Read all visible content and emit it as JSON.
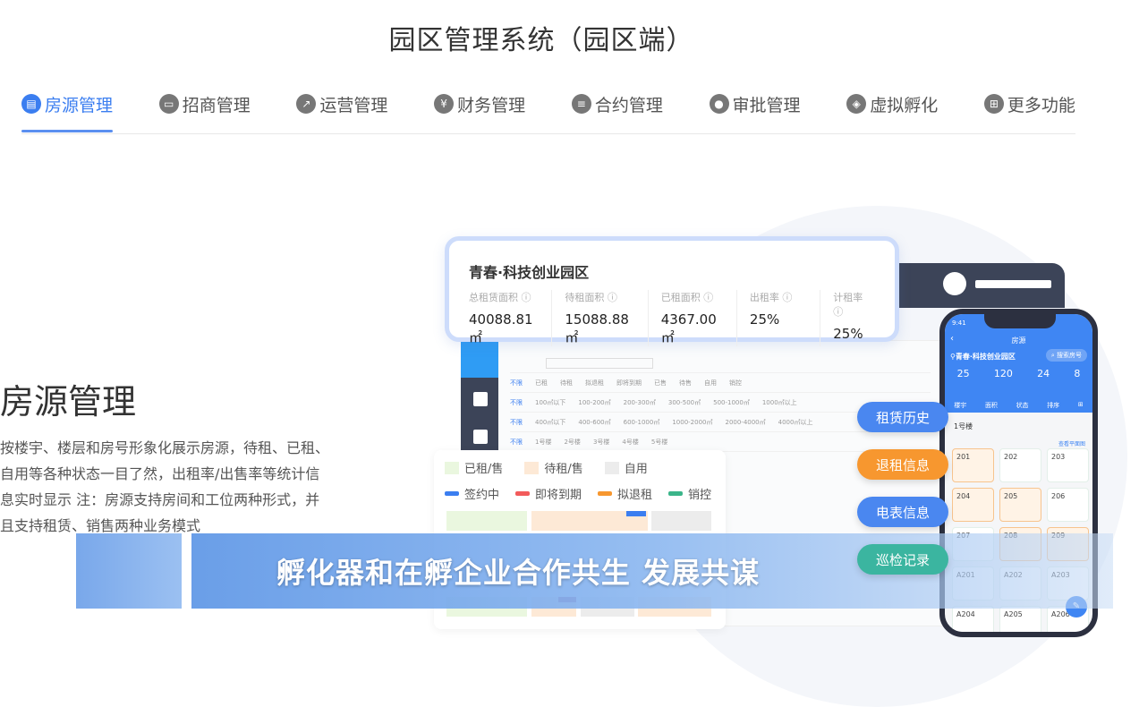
{
  "header": {
    "title": "园区管理系统（园区端）"
  },
  "nav": {
    "tabs": [
      {
        "label": "房源管理",
        "icon": "building-icon",
        "active": true
      },
      {
        "label": "招商管理",
        "icon": "briefcase-icon"
      },
      {
        "label": "运营管理",
        "icon": "chart-board-icon"
      },
      {
        "label": "财务管理",
        "icon": "yuan-icon"
      },
      {
        "label": "合约管理",
        "icon": "contract-icon"
      },
      {
        "label": "审批管理",
        "icon": "approval-icon"
      },
      {
        "label": "虚拟孵化",
        "icon": "incubation-icon"
      },
      {
        "label": "更多功能",
        "icon": "grid-icon"
      }
    ],
    "accent": "#3b7ef0"
  },
  "section": {
    "title": "房源管理",
    "description": "按楼宇、楼层和房号形象化展示房源，待租、已租、自用等各种状态一目了然，出租率/出售率等统计信息实时显示 注：房源支持房间和工位两种形式，并且支持租赁、销售两种业务模式"
  },
  "park_card": {
    "name": "青春·科技创业园区",
    "stats": [
      {
        "label": "总租赁面积",
        "value": "40088.81 ㎡"
      },
      {
        "label": "待租面积",
        "value": "15088.88 ㎡"
      },
      {
        "label": "已租面积",
        "value": "4367.00 ㎡"
      },
      {
        "label": "出租率",
        "value": "25%"
      },
      {
        "label": "计租率",
        "value": "25%"
      }
    ]
  },
  "legend": {
    "status": [
      {
        "label": "已租/售",
        "color": "#eaf7df"
      },
      {
        "label": "待租/售",
        "color": "#fde9d6"
      },
      {
        "label": "自用",
        "color": "#ececec"
      }
    ],
    "marks": [
      {
        "label": "签约中",
        "color": "#3b7ef0"
      },
      {
        "label": "即将到期",
        "color": "#f25b5b"
      },
      {
        "label": "拟退租",
        "color": "#f7972f"
      },
      {
        "label": "销控",
        "color": "#3bb58a"
      }
    ]
  },
  "phone": {
    "time": "9:41",
    "title": "房源",
    "park": "青春·科技创业园区",
    "search": "搜索房号",
    "stats": [
      "25",
      "120",
      "24",
      "8"
    ],
    "filters": [
      "楼宇",
      "面积",
      "状态",
      "排序"
    ],
    "building": "1号楼",
    "floor_plan": "查看平面图",
    "rooms": [
      "201",
      "202",
      "203",
      "204",
      "205",
      "206",
      "207",
      "208",
      "209",
      "A201",
      "A202",
      "A203",
      "A204",
      "A205",
      "A206"
    ]
  },
  "actions": [
    {
      "label": "租赁历史",
      "color": "#4a87f0"
    },
    {
      "label": "退租信息",
      "color": "#f7972f"
    },
    {
      "label": "电表信息",
      "color": "#4a87f0"
    },
    {
      "label": "巡检记录",
      "color": "#3bb5a0"
    }
  ],
  "subtitle": "孵化器和在孵企业合作共生  发展共谋"
}
